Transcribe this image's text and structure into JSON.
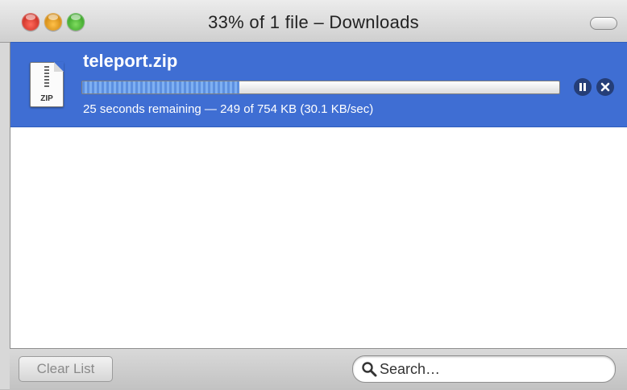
{
  "window": {
    "title": "33% of 1 file – Downloads"
  },
  "download": {
    "filename": "teleport.zip",
    "icon_label": "ZIP",
    "progress_fraction": 0.33,
    "status": "25 seconds remaining — 249 of 754 KB (30.1 KB/sec)"
  },
  "footer": {
    "clear_label": "Clear List",
    "search_placeholder": "Search…"
  },
  "colors": {
    "selection": "#3f6ed3",
    "progress_fill": "#5c8fe0"
  }
}
